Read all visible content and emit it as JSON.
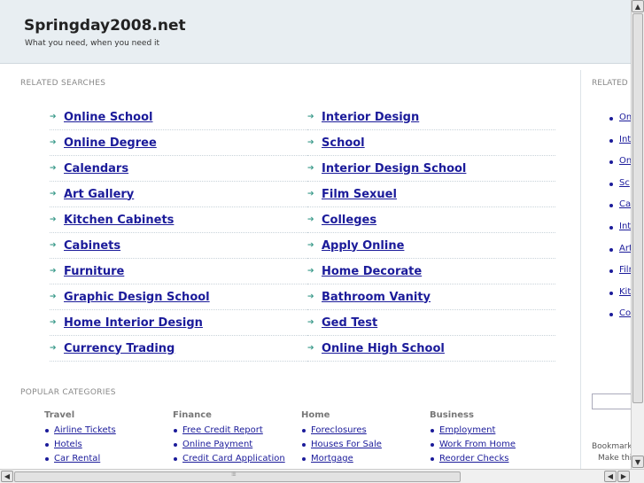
{
  "header": {
    "title": "Springday2008.net",
    "tagline": "What you need, when you need it"
  },
  "related": {
    "title": "RELATED SEARCHES",
    "left": [
      "Online School",
      "Online Degree",
      "Calendars",
      "Art Gallery",
      "Kitchen Cabinets",
      "Cabinets",
      "Furniture",
      "Graphic Design School",
      "Home Interior Design",
      "Currency Trading"
    ],
    "right": [
      "Interior Design",
      "School",
      "Interior Design School",
      "Film Sexuel",
      "Colleges",
      "Apply Online",
      "Home Decorate",
      "Bathroom Vanity",
      "Ged Test",
      "Online High School"
    ]
  },
  "popular": {
    "title": "POPULAR CATEGORIES",
    "categories": [
      {
        "name": "Travel",
        "links": [
          "Airline Tickets",
          "Hotels",
          "Car Rental"
        ]
      },
      {
        "name": "Finance",
        "links": [
          "Free Credit Report",
          "Online Payment",
          "Credit Card Application"
        ]
      },
      {
        "name": "Home",
        "links": [
          "Foreclosures",
          "Houses For Sale",
          "Mortgage"
        ]
      },
      {
        "name": "Business",
        "links": [
          "Employment",
          "Work From Home",
          "Reorder Checks"
        ]
      }
    ]
  },
  "sidebar": {
    "title": "RELATED",
    "links": [
      "Onl",
      "Inte",
      "Onl",
      "Sc",
      "Cal",
      "Inte",
      "Art",
      "Filr",
      "Kitc",
      "Co"
    ],
    "bookmark": "Bookmark",
    "make": "Make thi"
  },
  "scrollbars": {
    "up": "▲",
    "down": "▼",
    "left": "◀",
    "right": "▶",
    "grip": "⁞⁞⁞⁞"
  },
  "colors": {
    "link": "#1b1b9a",
    "arrow": "#3a9a8a",
    "header_bg": "#e8eef2"
  }
}
